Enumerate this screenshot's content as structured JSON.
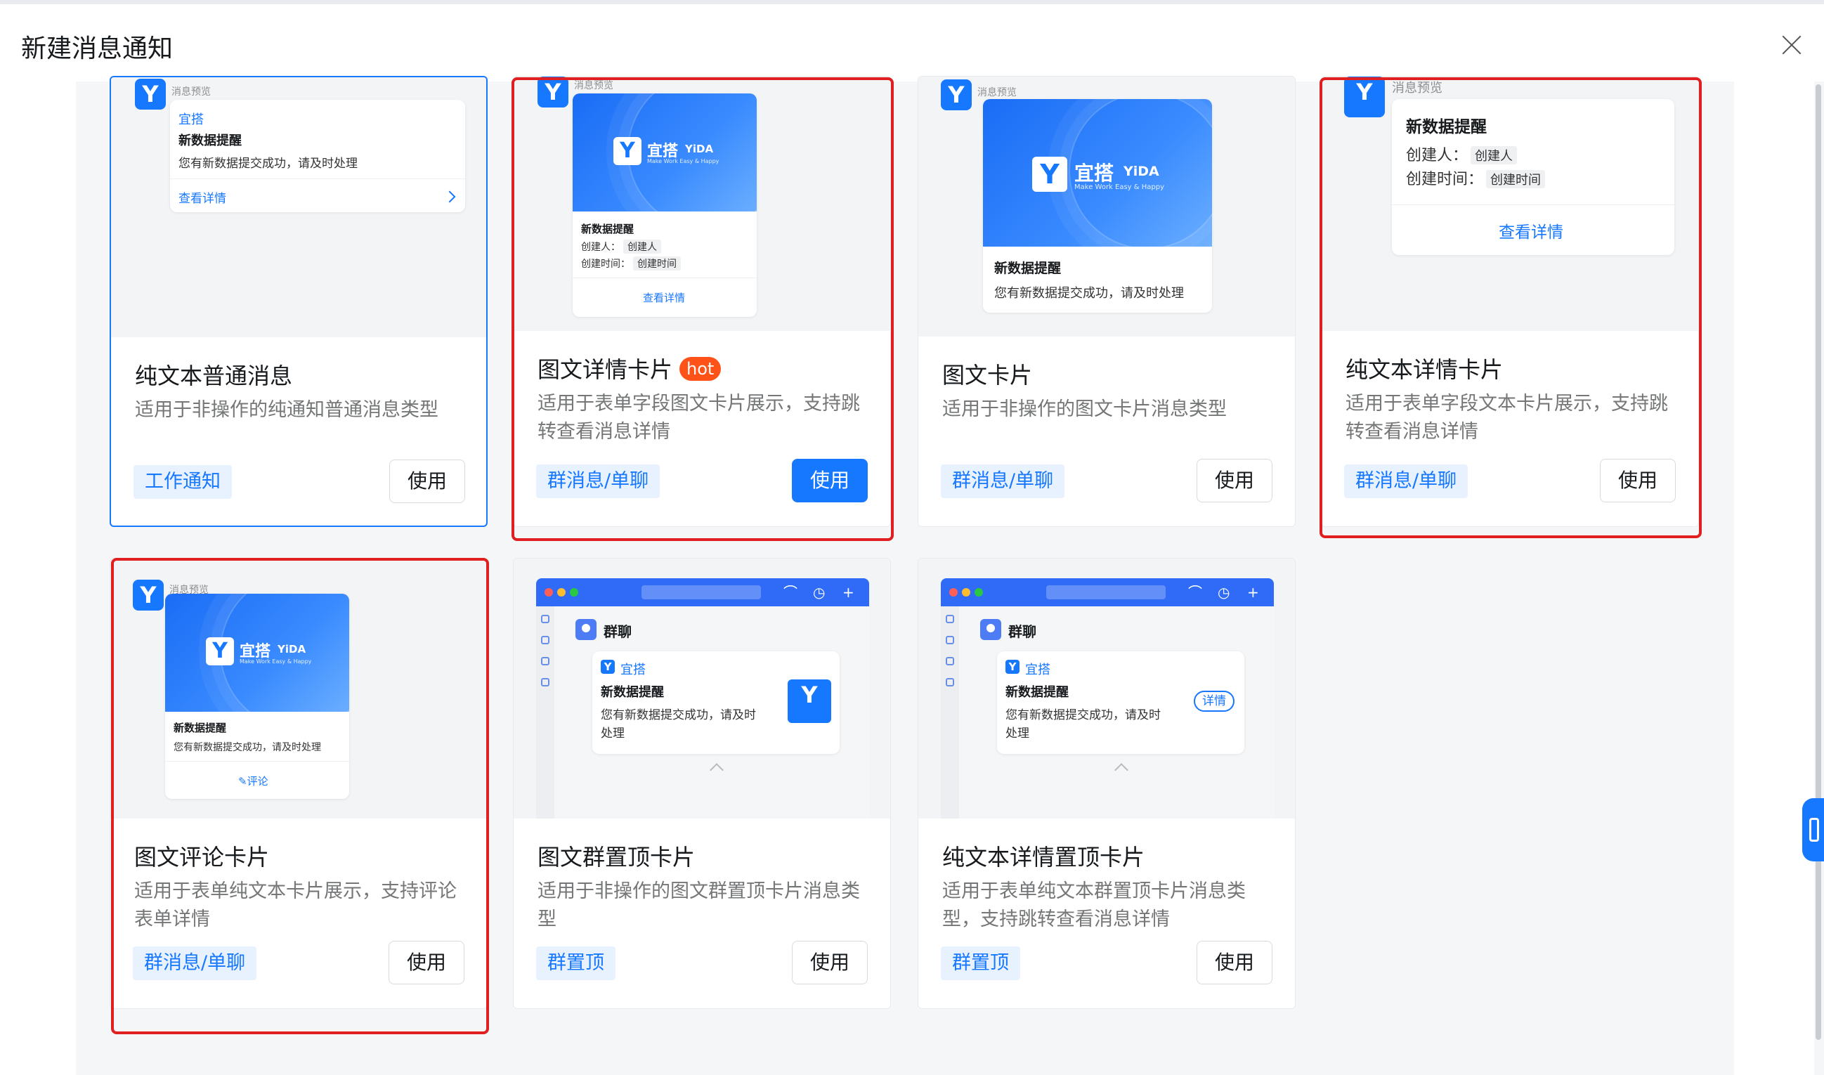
{
  "dialog": {
    "title": "新建消息通知"
  },
  "preview_label": "消息预览",
  "use_label": "使用",
  "hot_label": "hot",
  "brand": {
    "name": "宜搭",
    "en": "YiDA",
    "slogan": "Make Work Easy & Happy"
  },
  "colors": {
    "accent": "#1677ff",
    "hot": "#ff5219",
    "highlight": "#e02020"
  },
  "cards": [
    {
      "title": "纯文本普通消息",
      "desc": "适用于非操作的纯通知普通消息类型",
      "tag": "工作通知",
      "preview": {
        "app": "宜搭",
        "heading": "新数据提醒",
        "body": "您有新数据提交成功，请及时处理",
        "link": "查看详情"
      }
    },
    {
      "title": "图文详情卡片",
      "hot": true,
      "desc": "适用于表单字段图文卡片展示，支持跳转查看消息详情",
      "tag": "群消息/单聊",
      "preview": {
        "heading": "新数据提醒",
        "label1": "创建人：",
        "chip1": "创建人",
        "label2": "创建时间：",
        "chip2": "创建时间",
        "link": "查看详情"
      }
    },
    {
      "title": "图文卡片",
      "desc": "适用于非操作的图文卡片消息类型",
      "tag": "群消息/单聊",
      "preview": {
        "heading": "新数据提醒",
        "body": "您有新数据提交成功，请及时处理"
      }
    },
    {
      "title": "纯文本详情卡片",
      "desc": "适用于表单字段文本卡片展示，支持跳转查看消息详情",
      "tag": "群消息/单聊",
      "preview": {
        "heading": "新数据提醒",
        "label1": "创建人：",
        "chip1": "创建人",
        "label2": "创建时间：",
        "chip2": "创建时间",
        "link": "查看详情"
      }
    },
    {
      "title": "图文评论卡片",
      "desc": "适用于表单纯文本卡片展示，支持评论表单详情",
      "tag": "群消息/单聊",
      "preview": {
        "heading": "新数据提醒",
        "body": "您有新数据提交成功，请及时处理",
        "link": "评论"
      }
    },
    {
      "title": "图文群置顶卡片",
      "desc": "适用于非操作的图文群置顶卡片消息类型",
      "tag": "群置顶",
      "preview": {
        "group": "群聊",
        "app": "宜搭",
        "heading": "新数据提醒",
        "body1": "您有新数据提交成功，请及时",
        "body2": "处理"
      }
    },
    {
      "title": "纯文本详情置顶卡片",
      "desc": "适用于表单纯文本群置顶卡片消息类型，支持跳转查看消息详情",
      "tag": "群置顶",
      "preview": {
        "group": "群聊",
        "app": "宜搭",
        "heading": "新数据提醒",
        "body1": "您有新数据提交成功，请及时",
        "body2": "处理",
        "detail": "详情"
      }
    }
  ]
}
